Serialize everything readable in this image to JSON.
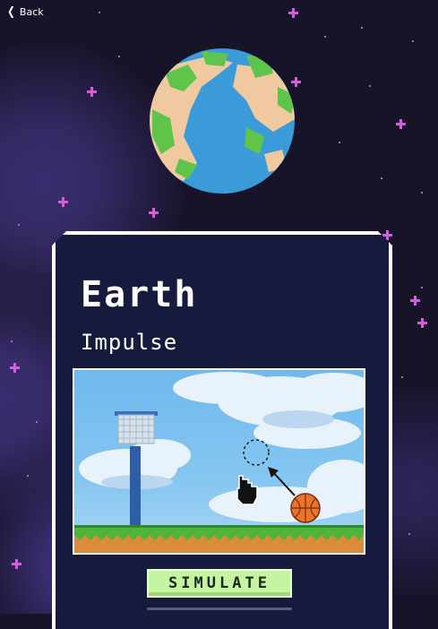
{
  "nav": {
    "back_label": "Back",
    "back_icon": "chevron-left-icon"
  },
  "planet": {
    "icon": "earth-planet-icon",
    "colors": {
      "ocean": "#3a9bd8",
      "land": "#f0c9a0",
      "forest": "#5ec44a"
    }
  },
  "card": {
    "title": "Earth",
    "subtitle": "Impulse",
    "scene_icons": [
      "basketball-hoop-icon",
      "basketball-icon",
      "hand-pointer-icon",
      "target-circle-icon",
      "impulse-arrow-icon"
    ],
    "button_label": "SIMULATE",
    "button_color": "#c5f5a0"
  },
  "colors": {
    "background": "#17142a",
    "nebula": "#3a2d6e",
    "card_bg": "#161a3d",
    "star": "#d45cdd"
  }
}
